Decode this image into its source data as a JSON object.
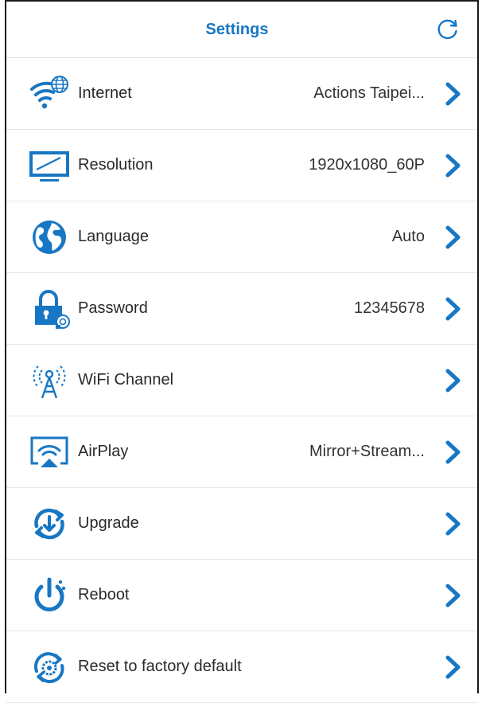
{
  "header": {
    "title": "Settings",
    "refresh_icon": "refresh-icon"
  },
  "colors": {
    "accent": "#1777c4",
    "text": "#2a2a2a",
    "divider": "#e6e6e6"
  },
  "settings": {
    "items": [
      {
        "label": "Internet",
        "value": "Actions Taipei...",
        "icon": "wifi-globe-icon"
      },
      {
        "label": "Resolution",
        "value": "1920x1080_60P",
        "icon": "monitor-icon"
      },
      {
        "label": "Language",
        "value": "Auto",
        "icon": "globe-icon"
      },
      {
        "label": "Password",
        "value": "12345678",
        "icon": "lock-icon"
      },
      {
        "label": "WiFi Channel",
        "value": "",
        "icon": "antenna-icon"
      },
      {
        "label": "AirPlay",
        "value": "Mirror+Stream...",
        "icon": "airplay-icon"
      },
      {
        "label": "Upgrade",
        "value": "",
        "icon": "upgrade-icon"
      },
      {
        "label": "Reboot",
        "value": "",
        "icon": "power-icon"
      },
      {
        "label": "Reset to factory default",
        "value": "",
        "icon": "reset-gear-icon"
      }
    ]
  }
}
